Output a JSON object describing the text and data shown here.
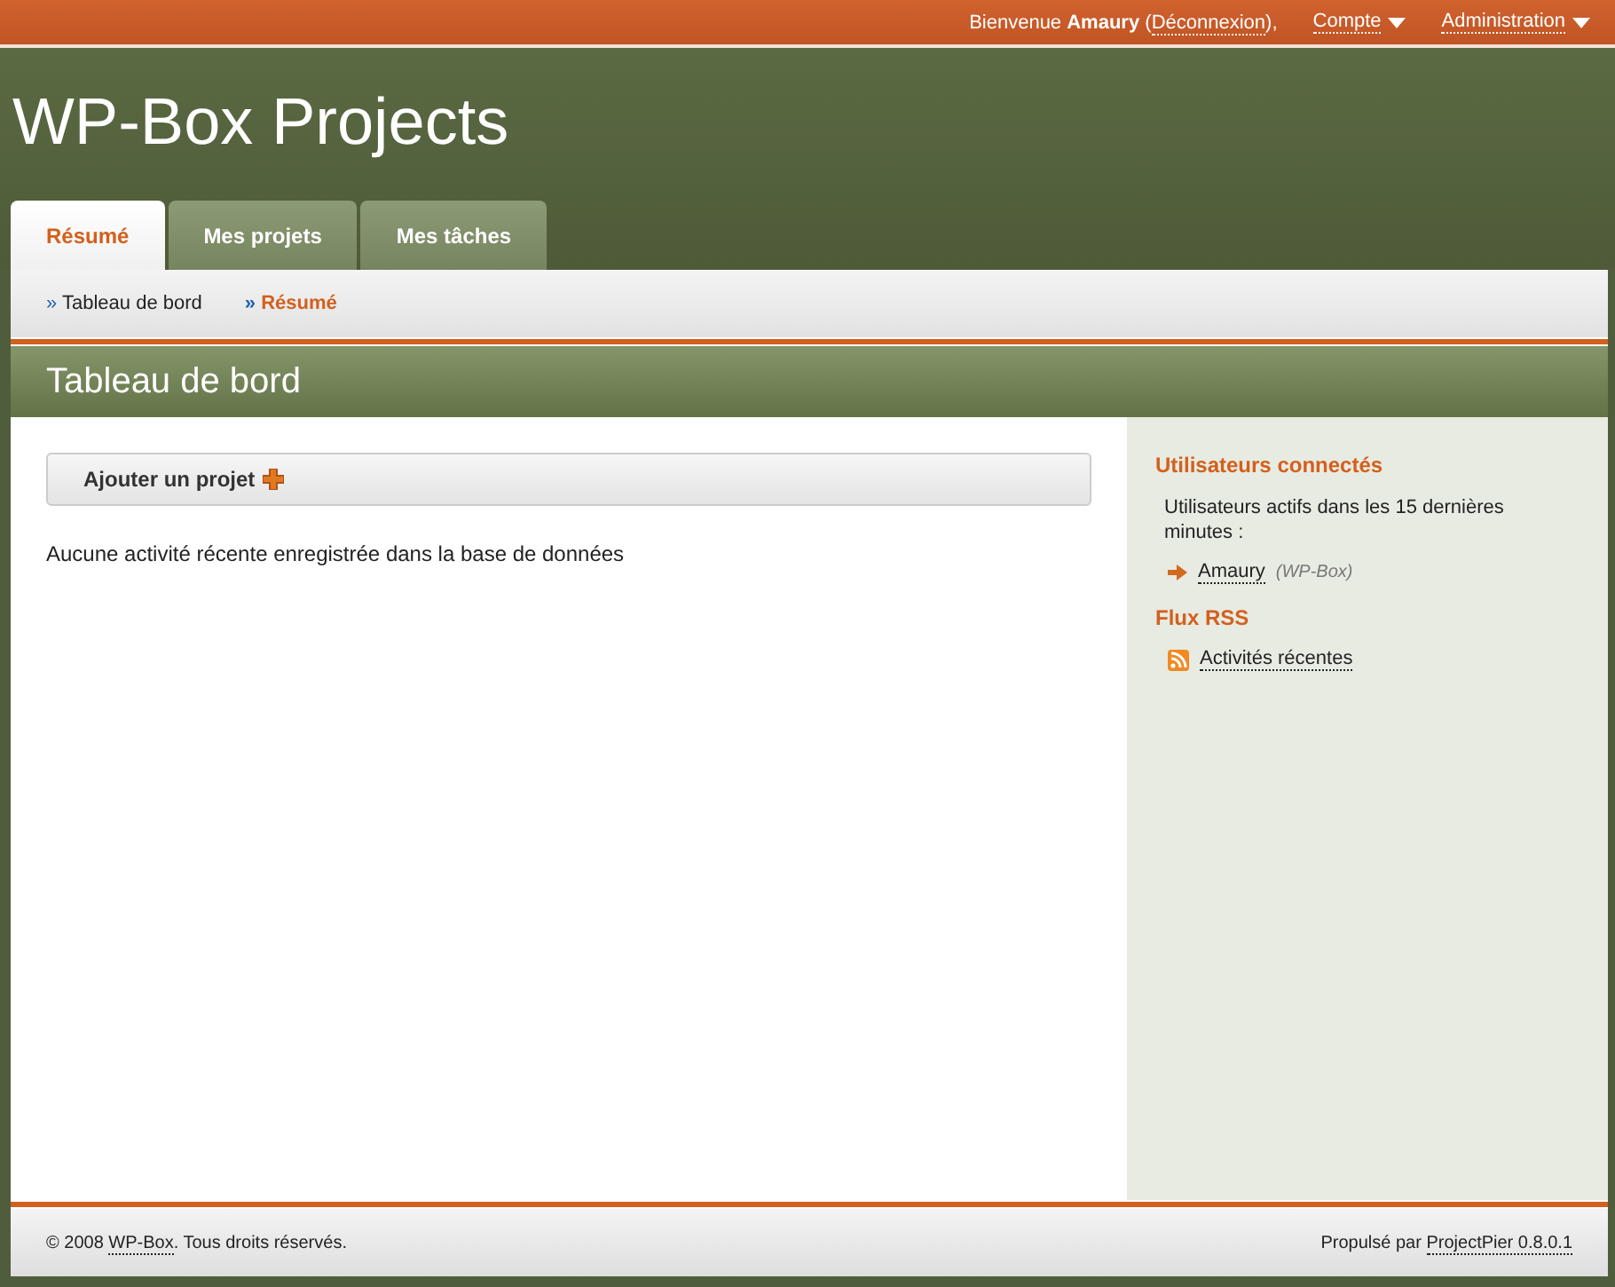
{
  "top_bar": {
    "welcome": {
      "before": "Bienvenue ",
      "user": "Amaury",
      "open": " (",
      "link": "Déconnexion",
      "after": "),"
    },
    "menus": [
      {
        "label": "Compte"
      },
      {
        "label": "Administration"
      }
    ]
  },
  "site_title": "WP-Box Projects",
  "tabs": [
    {
      "label": "Résumé",
      "selected": true
    },
    {
      "label": "Mes projets",
      "selected": false
    },
    {
      "label": "Mes tâches",
      "selected": false
    }
  ],
  "breadcrumbs": [
    {
      "marker": "»",
      "label": "Tableau de bord",
      "current": false
    },
    {
      "marker": "»",
      "label": "Résumé",
      "current": true
    }
  ],
  "page_title": "Tableau de bord",
  "main": {
    "add_button": "Ajouter un projet",
    "message": "Aucune activité récente enregistrée dans la base de données"
  },
  "sidebar": {
    "sections": [
      {
        "title": "Utilisateurs connectés",
        "kind": "users",
        "note": "Utilisateurs actifs dans les 15 dernières minutes :",
        "items": [
          {
            "label": "Amaury",
            "detail": "(WP-Box)"
          }
        ]
      },
      {
        "title": "Flux RSS",
        "kind": "rss",
        "items": [
          {
            "label": "Activités récentes"
          }
        ]
      }
    ]
  },
  "footer": {
    "copyright": {
      "before": "© 2008 ",
      "link": "WP-Box",
      "after": ". Tous droits réservés."
    },
    "powered": {
      "before": "Propulsé par ",
      "link": "ProjectPier 0.8.0.1"
    }
  }
}
